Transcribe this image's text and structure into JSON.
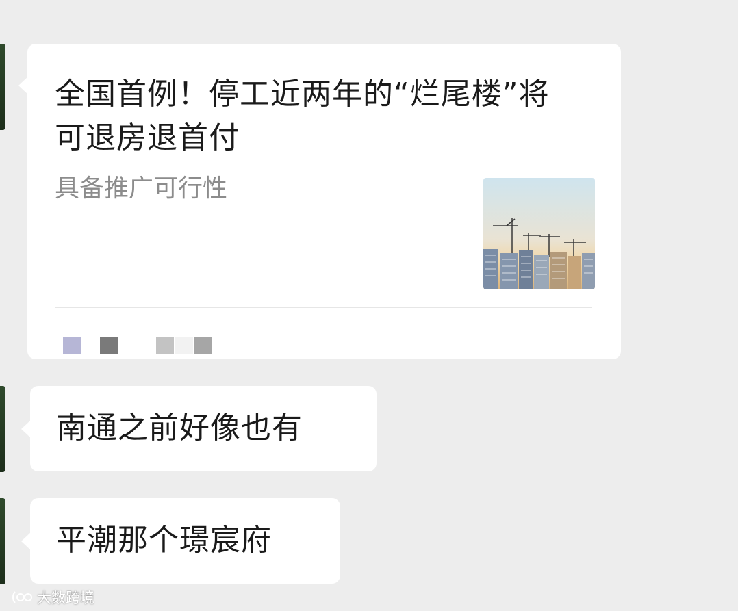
{
  "chat": {
    "card": {
      "title": "全国首例！停工近两年的“烂尾楼”将可退房退首付",
      "description": "具备推广可行性",
      "source_blocks": [
        "#b6b6d6",
        "#7a7a7a",
        "#c3c3c3",
        "#f2f2f2",
        "#a6a6a6"
      ]
    },
    "messages": [
      {
        "text": "南通之前好像也有"
      },
      {
        "text": "平潮那个璟宸府"
      }
    ]
  },
  "watermark": {
    "text": "大数跨境"
  }
}
